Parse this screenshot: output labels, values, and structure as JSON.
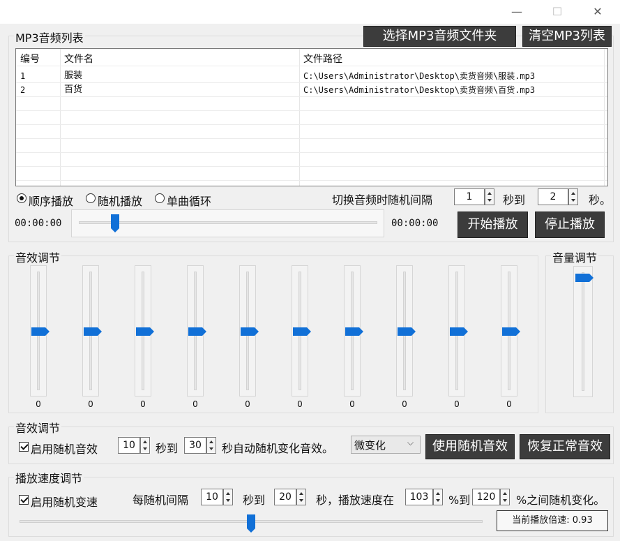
{
  "window": {
    "minimize": "—",
    "maximize": "☐",
    "close": "✕"
  },
  "playlist": {
    "group_label": "MP3音频列表",
    "select_folder_button": "选择MP3音频文件夹",
    "clear_button": "清空MP3列表",
    "columns": [
      "编号",
      "文件名",
      "文件路径"
    ],
    "rows": [
      {
        "id": "1",
        "name": "服装",
        "path": "C:\\Users\\Administrator\\Desktop\\卖货音频\\服装.mp3"
      },
      {
        "id": "2",
        "name": "百货",
        "path": "C:\\Users\\Administrator\\Desktop\\卖货音频\\百货.mp3"
      }
    ]
  },
  "playmode": {
    "options": [
      "顺序播放",
      "随机播放",
      "单曲循环"
    ],
    "selected": "顺序播放",
    "interval_label": "切换音频时随机间隔",
    "interval_min": "1",
    "to_label": "秒到",
    "interval_max": "2",
    "sec_label": "秒。"
  },
  "player": {
    "current_time": "00:00:00",
    "total_time": "00:00:00",
    "progress": 0.11,
    "start_button": "开始播放",
    "stop_button": "停止播放"
  },
  "equalizer": {
    "group_label": "音效调节",
    "values": [
      "0",
      "0",
      "0",
      "0",
      "0",
      "0",
      "0",
      "0",
      "0",
      "0"
    ],
    "volume_label": "音量调节",
    "volume_level": 1.0
  },
  "effects": {
    "group_label": "音效调节",
    "checkbox_label": "启用随机音效",
    "checked": true,
    "min": "10",
    "to_label": "秒到",
    "max": "30",
    "suffix": "秒自动随机变化音效。",
    "mode_select": "微变化",
    "use_button": "使用随机音效",
    "restore_button": "恢复正常音效"
  },
  "speed": {
    "group_label": "播放速度调节",
    "checkbox_label": "启用随机变速",
    "checked": true,
    "every_label": "每随机间隔",
    "min_sec": "10",
    "to_label": "秒到",
    "max_sec": "20",
    "mid_label": "秒，播放速度在",
    "min_pct": "103",
    "pct_to": "%到",
    "max_pct": "120",
    "tail_label": "%之间随机变化。",
    "slider_level": 0.5,
    "current_rate": "当前播放倍速: 0.93"
  },
  "colors": {
    "accent": "#1170d7",
    "dark_button": "#3c3c3c",
    "background": "#f0f0f0"
  }
}
